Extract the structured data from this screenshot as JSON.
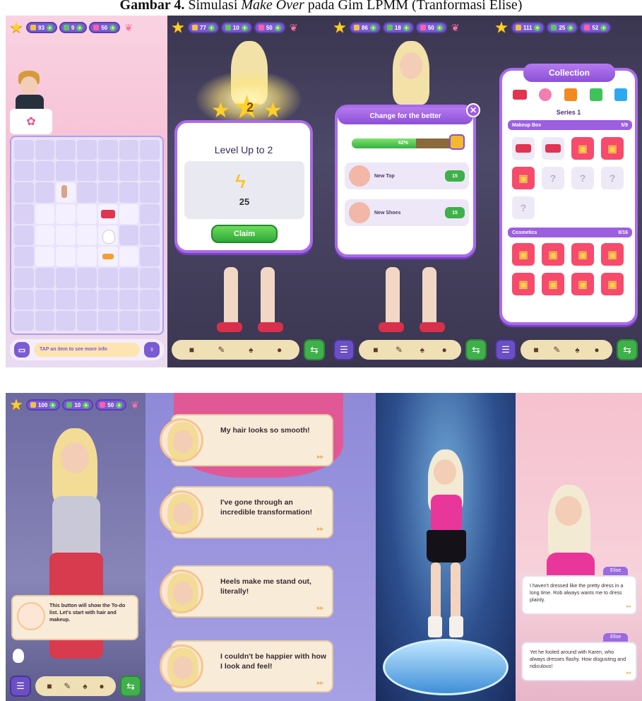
{
  "caption": {
    "label": "Gambar 4.",
    "text": " Simulasi ",
    "italic": "Make Over",
    "rest": " pada Gim LPMM (Tranformasi Elise)"
  },
  "screens_top": [
    {
      "stats": [
        "93",
        "9",
        "50"
      ]
    },
    {
      "stats": [
        "77",
        "10",
        "50"
      ]
    },
    {
      "stats": [
        "86",
        "18",
        "50"
      ]
    },
    {
      "stats": [
        "111",
        "25",
        "52"
      ]
    }
  ],
  "merge_board": {
    "info_text": "TAP an item to see more info"
  },
  "level_up": {
    "level": "2",
    "title": "Level Up to 2",
    "reward": "25",
    "claim": "Claim"
  },
  "change": {
    "title": "Change for the better",
    "progress": 0.62,
    "progress_text": "62%",
    "tasks": [
      {
        "label": "New Top",
        "cost": "15"
      },
      {
        "label": "New Shoes",
        "cost": "15"
      }
    ]
  },
  "collection": {
    "title": "Collection",
    "series": "Series 1",
    "sections": [
      {
        "name": "Makeup Box",
        "count": "5/9"
      },
      {
        "name": "Cosmetics",
        "count": "8/16"
      }
    ],
    "unknown": "?"
  },
  "screens_bottom": {
    "stats": [
      "100",
      "10",
      "50"
    ]
  },
  "tutorial": {
    "text": "This button will show the To-do list. Let's start with hair and makeup."
  },
  "dialogues": [
    "My hair looks so smooth!",
    "I've gone through an incredible transformation!",
    "Heels make me stand out, literally!",
    "I couldn't be happier with how I look and feel!"
  ],
  "elise": {
    "name": "Elise",
    "line1": "I haven't dressed like the pretty dress in a long time. Rob always wants me to dress plainly.",
    "line2": "Yet he fooled around with Karen, who always dresses flashy. How disgusting and ridiculous!"
  },
  "icons": {
    "arrow": "▸▸",
    "plus": "+",
    "close": "✕",
    "todo": "☰",
    "swap": "⇆"
  },
  "colors": {
    "accent": "#7b5bd3",
    "green": "#3fb04a",
    "gold": "#ffcf2a",
    "pink": "#ff6fa8"
  }
}
